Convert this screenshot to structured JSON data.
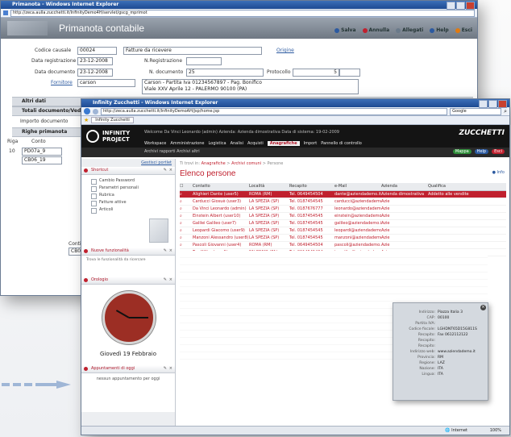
{
  "back_window": {
    "ie_title": "Primanota - Windows Internet Explorer",
    "url": "http://zeca.aulla.zucchetti.it/InfinityDemo4H/servlet/gscg_mprimot",
    "app_title": "Primanota contabile",
    "toolbar": [
      "Salva",
      "Annulla",
      "Allegati",
      "Help",
      "Esci"
    ],
    "fields": {
      "codice_causale_label": "Codice causale",
      "codice_causale_value": "00024",
      "causale_desc": "Fatture da ricevere",
      "origine_label": "Origine",
      "data_registrazione_label": "Data registrazione",
      "data_registrazione_value": "23-12-2008",
      "n_registrazione_label": "N.Registrazione",
      "data_documento_label": "Data documento",
      "data_documento_value": "23-12-2008",
      "n_documento_label": "N. documento",
      "n_documento_value": "25",
      "protocollo_label": "Protocollo",
      "protocollo_value": "5",
      "fornitore_label": "Fornitore",
      "fornitore_value": "carson",
      "fornitore_info_1": "Carson - Partita Iva 01234567897 - Pag. Bonifico",
      "fornitore_info_2": "Viale XXV Aprile 12 - PALERMO 90100 (PA)"
    },
    "sections": [
      "Altri dati",
      "Totali documento/Vedi",
      "Righe primanota"
    ],
    "importo_label": "Importo documento",
    "righe_headers": [
      "Riga",
      "Conto"
    ],
    "righe": [
      [
        "10",
        "PD07a_9"
      ],
      [
        "",
        "CB06_19"
      ]
    ],
    "side_labels": [
      "Conti",
      "CB0"
    ]
  },
  "front_window": {
    "ie_title": "Infinity Zucchetti - Windows Internet Explorer",
    "url": "http://zeca.aulla.zucchetti.it/InfinityDemoAH/jsp/home.jsp",
    "tab": "Infinity Zucchetti",
    "search": "Google",
    "logo_line1": "INFINITY",
    "logo_line2": "PROJECT",
    "welcome": "Welcome  Da Vinci Leonardo (admin)   Azienda: Azienda dimostrativa   Data di sistema: 19-02-2009",
    "menu": [
      "Workspace",
      "Amministrazione",
      "Logistica",
      "Analisi",
      "Acquisti",
      "Anagrafiche",
      "Import",
      "Pannello di controllo"
    ],
    "active_menu": "Anagrafiche",
    "brand": "ZUCCHETTI",
    "subbar": [
      "Mappa",
      "Help",
      "Esci"
    ],
    "archive_links": "Archivi rapporti   Archivi altri",
    "breadcrumb_prefix": "Ti trovi in:",
    "breadcrumb": [
      "Anagrafiche",
      "Archivi comuni",
      "Persone"
    ],
    "page_title": "Elenco persone",
    "info_label": "Info",
    "grid_headers": [
      "Contatto",
      "Località",
      "Recapito",
      "e-Mail",
      "Azienda",
      "Qualifica"
    ],
    "rows": [
      [
        "Alighieri Dante (user5)",
        "ROMA (RM)",
        "Tel. 0649454504",
        "dante@aziendademo.it",
        "Azienda dimostrativa",
        "Addetto alle vendite"
      ],
      [
        "Carducci Giosuè (user3)",
        "LA SPEZIA (SP)",
        "Tel. 0187454545",
        "carducci@aziendademo.it",
        "Azie",
        ""
      ],
      [
        "Da Vinci Leonardo (admin)",
        "LA SPEZIA (SP)",
        "Tel. 0187676777",
        "leonardo@aziendademo.it",
        "Azie",
        ""
      ],
      [
        "Einstein Albert (user10)",
        "LA SPEZIA (SP)",
        "Tel. 0187454545",
        "einstein@aziendademo.it",
        "Azie",
        ""
      ],
      [
        "Galilei Galileo (user7)",
        "LA SPEZIA (SP)",
        "Tel. 0187454545",
        "galileo@aziendademo.it",
        "Azie",
        ""
      ],
      [
        "Leopardi Giacomo (user9)",
        "LA SPEZIA (SP)",
        "Tel. 0187454545",
        "leopardi@aziendademo.it",
        "Azie",
        ""
      ],
      [
        "Manzoni Alessandro (user8)",
        "LA SPEZIA (SP)",
        "Tel. 0187454545",
        "manzoni@aziendademo.it",
        "Azie",
        ""
      ],
      [
        "Pascoli Giovanni (user4)",
        "ROMA (RM)",
        "Tel. 0649454504",
        "pascoli@aziendademo.it",
        "Azie",
        ""
      ],
      [
        "Tex Willer (user6)",
        "PALERMO (PA)",
        "Tel. 0914545464",
        "texwiller@aziendademo.it",
        "Azie",
        ""
      ]
    ],
    "popup": [
      [
        "Indirizzo:",
        "Piazza Italia 3"
      ],
      [
        "CAP:",
        "00100"
      ],
      [
        "Partita IVA:",
        ""
      ],
      [
        "Codice fiscale:",
        "LGHDNT65D15G811S"
      ],
      [
        "Recapito:",
        "Fax 0612112122"
      ],
      [
        "Recapito:",
        ""
      ],
      [
        "Recapito:",
        ""
      ],
      [
        "Indirizzo web:",
        "www.aziendademo.it"
      ],
      [
        "Provincia:",
        "RM"
      ],
      [
        "Regione:",
        "LAZ"
      ],
      [
        "Nazione:",
        "ITA"
      ],
      [
        "Lingua:",
        "ITA"
      ]
    ],
    "sidebar": {
      "portal_link": "Gestisci portlet",
      "shortcuts_title": "Shortcut",
      "shortcuts": [
        "Cambio Password",
        "Parametri personali",
        "Rubrica",
        "Fatture attive",
        "Articoli"
      ],
      "news_title": "Nuove funzionalità",
      "news_text": "Trova le funzionalità da ricercare",
      "clock_title": "Orologio",
      "date_text": "Giovedì 19 Febbraio",
      "appointments_title": "Appuntamenti di oggi",
      "appointments_text": "nessun appuntamento per oggi"
    },
    "status": {
      "zone": "Internet",
      "zoom": "100%"
    }
  },
  "colors": {
    "accent": "#c0202e",
    "ie_blue": "#1d4a92",
    "header_dark": "#141414"
  }
}
